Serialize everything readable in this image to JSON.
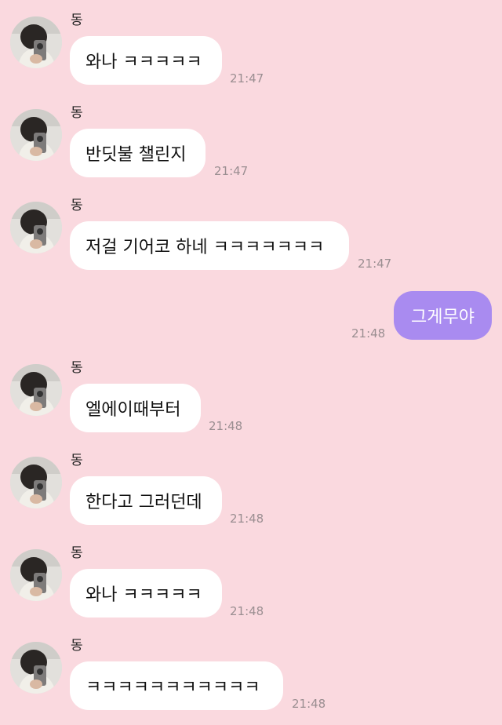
{
  "chat": {
    "messages": [
      {
        "sender": "동",
        "text": "와나 ㅋㅋㅋㅋㅋ",
        "time": "21:47"
      },
      {
        "sender": "동",
        "text": "반딧불 챌린지",
        "time": "21:47"
      },
      {
        "sender": "동",
        "text": "저걸 기어코 하네 ㅋㅋㅋㅋㅋㅋㅋ",
        "time": "21:47"
      },
      {
        "text": "그게무야",
        "time": "21:48"
      },
      {
        "sender": "동",
        "text": "엘에이때부터",
        "time": "21:48"
      },
      {
        "sender": "동",
        "text": "한다고 그러던데",
        "time": "21:48"
      },
      {
        "sender": "동",
        "text": "와나 ㅋㅋㅋㅋㅋ",
        "time": "21:48"
      },
      {
        "sender": "동",
        "text": "ㅋㅋㅋㅋㅋㅋㅋㅋㅋㅋㅋ",
        "time": "21:48"
      }
    ]
  }
}
